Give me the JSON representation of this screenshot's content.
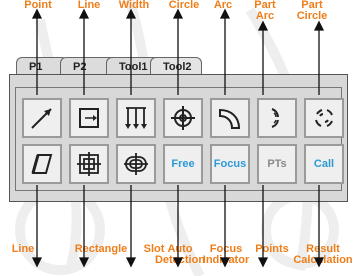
{
  "callouts_top": [
    {
      "id": "point",
      "lines": [
        "Point"
      ]
    },
    {
      "id": "line-top",
      "lines": [
        "Line"
      ]
    },
    {
      "id": "width",
      "lines": [
        "Width"
      ]
    },
    {
      "id": "circle",
      "lines": [
        "Circle"
      ]
    },
    {
      "id": "arc",
      "lines": [
        "Arc"
      ]
    },
    {
      "id": "part-arc",
      "lines": [
        "Part",
        "Arc"
      ]
    },
    {
      "id": "part-circle",
      "lines": [
        "Part",
        "Circle"
      ]
    }
  ],
  "callouts_bottom": [
    {
      "id": "line-bottom",
      "lines": [
        "Line"
      ]
    },
    {
      "id": "rectangle",
      "lines": [
        "Rectangle"
      ]
    },
    {
      "id": "slot",
      "lines": [
        "Slot"
      ]
    },
    {
      "id": "auto-detection",
      "lines": [
        "Auto",
        "Detection"
      ]
    },
    {
      "id": "focus-indicator",
      "lines": [
        "Focus",
        "Indicator"
      ]
    },
    {
      "id": "points",
      "lines": [
        "Points"
      ]
    },
    {
      "id": "result-calculation",
      "lines": [
        "Result",
        "Calculation"
      ]
    }
  ],
  "tabs": [
    {
      "id": "p1",
      "label": "P1"
    },
    {
      "id": "p2",
      "label": "P2"
    },
    {
      "id": "tool1",
      "label": "Tool1"
    },
    {
      "id": "tool2",
      "label": "Tool2"
    }
  ],
  "toolbar": {
    "row1_icons": [
      "point-arrow-icon",
      "line-bracket-icon",
      "width-arrows-icon",
      "circle-crosshair-icon",
      "arc-icon",
      "part-arc-icon",
      "part-circle-icon"
    ],
    "row2_icons": [
      "parallelogram-line-icon",
      "rectangle-crosshair-icon",
      "slot-icon"
    ],
    "row2_text_buttons": [
      {
        "id": "free",
        "label": "Free"
      },
      {
        "id": "focus",
        "label": "Focus"
      },
      {
        "id": "pts",
        "label": "PTs"
      },
      {
        "id": "call",
        "label": "Call"
      }
    ]
  },
  "colors": {
    "callout": "#ef7d1a",
    "button_text_blue": "#2b9ad6",
    "button_text_grey": "#8a8a8a",
    "panel": "#d8d8d8"
  }
}
